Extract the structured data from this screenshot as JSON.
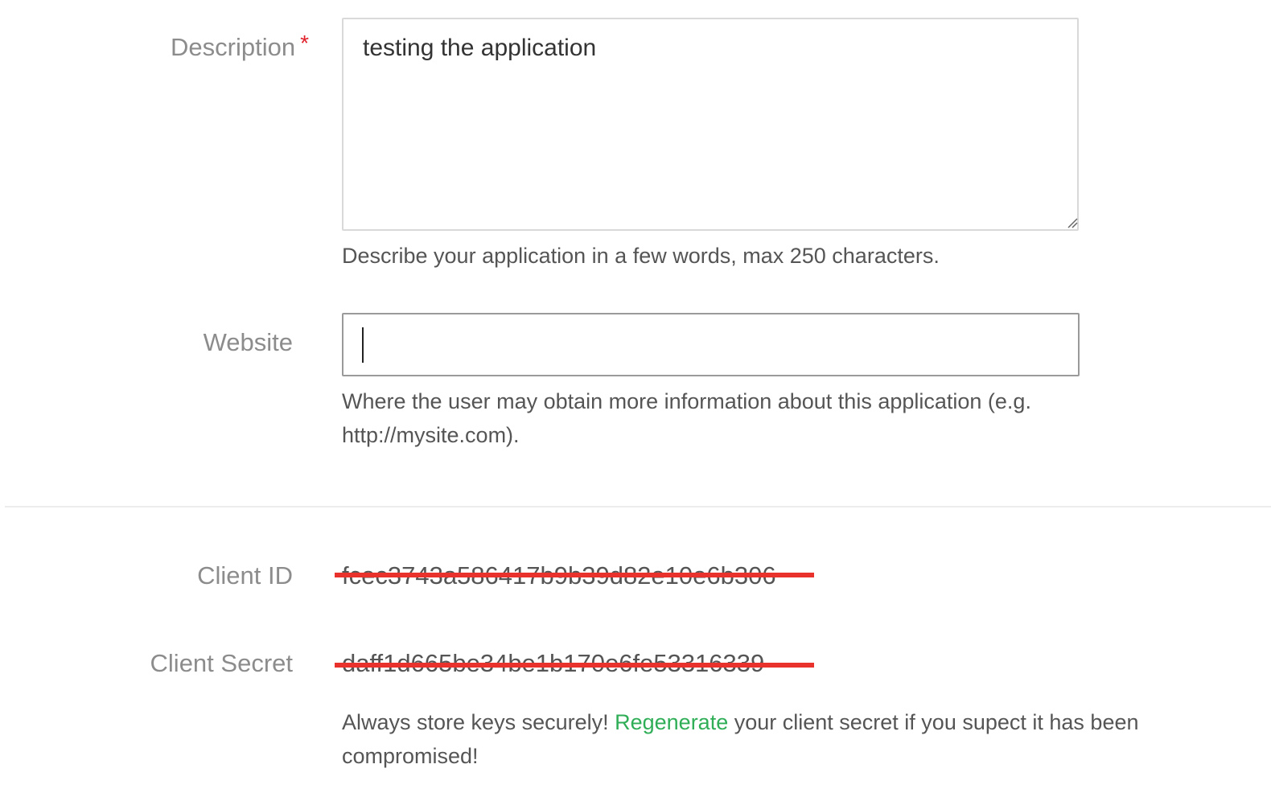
{
  "form": {
    "description": {
      "label": "Description",
      "required_mark": "*",
      "value": "testing the application",
      "help": "Describe your application in a few words, max 250 characters."
    },
    "website": {
      "label": "Website",
      "value": "",
      "help": "Where the user may obtain more information about this application (e.g. http://mysite.com)."
    }
  },
  "credentials": {
    "client_id": {
      "label": "Client ID",
      "value": "fcec3743a586417b9b39d82e10e6b306"
    },
    "client_secret": {
      "label": "Client Secret",
      "value": "daff1d665be34be1b170e6fe53316339"
    },
    "help_prefix": "Always store keys securely! ",
    "regenerate_link": "Regenerate",
    "help_suffix": " your client secret if you supect it has been compromised!"
  },
  "colors": {
    "required": "#e0202a",
    "link": "#2fae57",
    "redaction": "#e8322b"
  }
}
